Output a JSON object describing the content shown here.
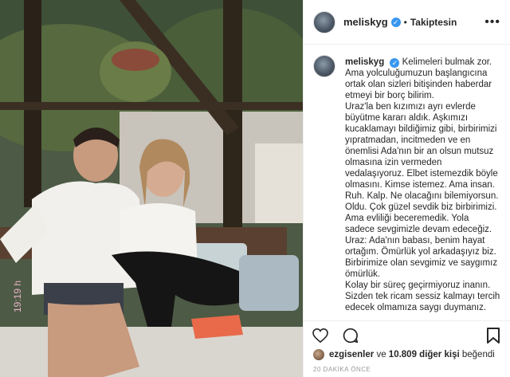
{
  "post": {
    "username": "meliskyg",
    "verified_badge": "✓",
    "separator": "•",
    "follow_status": "Takiptesin",
    "more_icon": "•••"
  },
  "caption": {
    "username": "meliskyg",
    "lines": [
      "Kelimeleri bulmak zor.",
      "Ama yolculuğumuzun başlangıcına ortak olan sizleri bitişinden haberdar etmeyi bir borç bilirim.",
      "Uraz'la ben kızımızı ayrı evlerde büyütme kararı aldık. Aşkımızı kucaklamayı bildiğimiz gibi, birbirimizi yıpratmadan, incitmeden ve en önemlisi Ada'nın bir an olsun mutsuz olmasına izin vermeden vedalaşıyoruz. Elbet istemezdik böyle olmasını. Kimse istemez. Ama insan. Ruh. Kalp. Ne olacağını bilemiyorsun. Oldu. Çok güzel sevdik biz birbirimizi. Ama evliliği beceremedik. Yola sadece sevgimizle devam edeceğiz.",
      "Uraz: Ada'nın babası, benim hayat ortağım. Ömürlük yol arkadaşıyız biz. Birbirimize olan sevgimiz ve saygımız ömürlük.",
      "Kolay bir süreç geçirmiyoruz inanın. Sizden tek ricam sessiz kalmayı tercih edecek olmamıza saygı duymanız."
    ]
  },
  "photo": {
    "timestamp_overlay": "19:19 h"
  },
  "actions": {
    "like_icon": "heart-icon",
    "comment_icon": "comment-icon",
    "bookmark_icon": "bookmark-icon"
  },
  "likes": {
    "first_liker": "ezgisenler",
    "connector": " ve ",
    "others_count": "10.809 diğer kişi",
    "suffix": " beğendi"
  },
  "timestamp": "20 DAKİKA ÖNCE"
}
